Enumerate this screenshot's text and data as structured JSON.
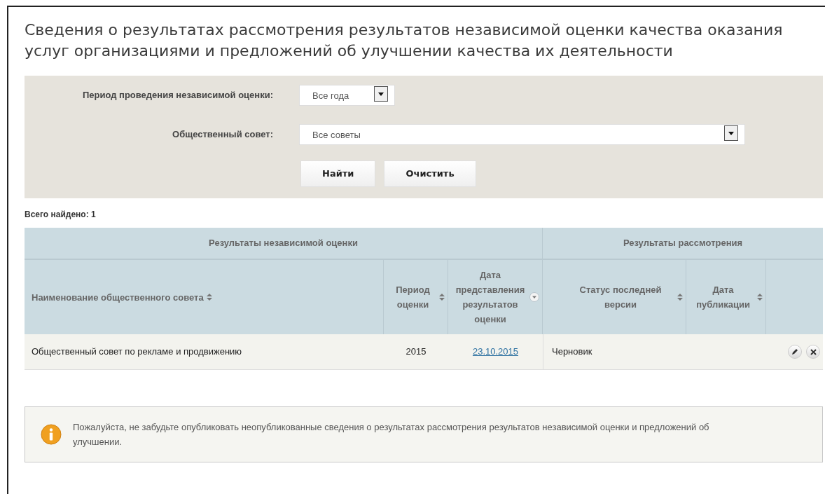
{
  "title": "Сведения о результатах рассмотрения результатов независимой оценки качества оказания услуг организациями и предложений об улучшении качества их деятельности",
  "filters": [
    {
      "label": "Период проведения независимой оценки:",
      "value": "Все года",
      "kind": "short"
    },
    {
      "label": "Общественный совет:",
      "value": "Все советы",
      "kind": "wide"
    }
  ],
  "buttons": [
    {
      "label": "Найти"
    },
    {
      "label": "Очистить"
    }
  ],
  "total": "Всего найдено: 1",
  "table": {
    "groups": [
      "Результаты независимой оценки",
      "Результаты рассмотрения"
    ],
    "columns": [
      {
        "label": "Наименование общественного совета",
        "sorted": false
      },
      {
        "label": "Период оценки",
        "sorted": false
      },
      {
        "label": "Дата представления результатов оценки",
        "sorted": true
      },
      {
        "label": "Статус последней версии",
        "sorted": false
      },
      {
        "label": "Дата публикации",
        "sorted": false
      }
    ],
    "rows": [
      {
        "cells": [
          "Общественный совет по рекламе и продвижению",
          "2015",
          "23.10.2015",
          "Черновик"
        ]
      }
    ]
  },
  "notice": "Пожалуйста, не забудьте опубликовать неопубликованные сведения о результатах рассмотрения результатов независимой оценки и предложений об улучшении."
}
